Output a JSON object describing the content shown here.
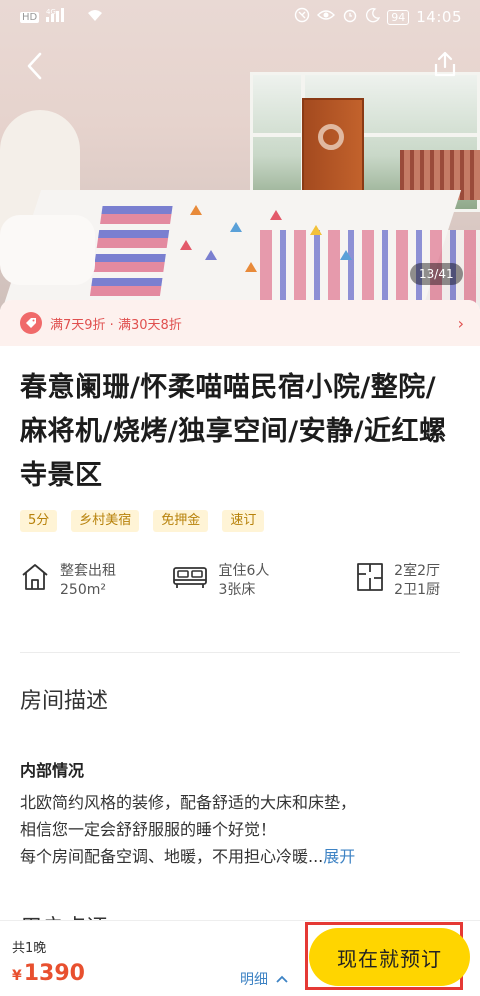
{
  "status_bar": {
    "network_label": "HD",
    "signal_label": "4G",
    "battery": "94",
    "time": "14:05"
  },
  "gallery": {
    "counter": "13/41"
  },
  "promo": {
    "text": "满7天9折 · 满30天8折"
  },
  "listing": {
    "title": "春意阑珊/怀柔喵喵民宿小院/整院/麻将机/烧烤/独享空间/安静/近红螺寺景区",
    "tags": [
      "5分",
      "乡村美宿",
      "免押金",
      "速订"
    ],
    "facts": [
      {
        "line1": "整套出租",
        "line2": "250m²",
        "icon": "house-icon"
      },
      {
        "line1": "宜住6人",
        "line2": "3张床",
        "icon": "bed-icon"
      },
      {
        "line1": "2室2厅",
        "line2": "2卫1厨",
        "icon": "floorplan-icon"
      }
    ]
  },
  "description": {
    "section_title": "房间描述",
    "sub_title": "内部情况",
    "line1": "北欧简约风格的装修，配备舒适的大床和床垫，",
    "line2": "相信您一定会舒舒服服的睡个好觉！",
    "line3": "每个房间配备空调、地暖，不用担心冷暖...",
    "expand": "展开"
  },
  "reviews": {
    "section_title": "用户点评"
  },
  "bottom_bar": {
    "nights": "共1晚",
    "currency": "¥",
    "price": "1390",
    "detail_label": "明细",
    "book_label": "现在就预订"
  },
  "colors": {
    "accent_yellow": "#ffd500",
    "price_red": "#e8502f",
    "promo_red": "#e0504f",
    "link_blue": "#3e83c4",
    "tag_gold": "#b7810a"
  }
}
